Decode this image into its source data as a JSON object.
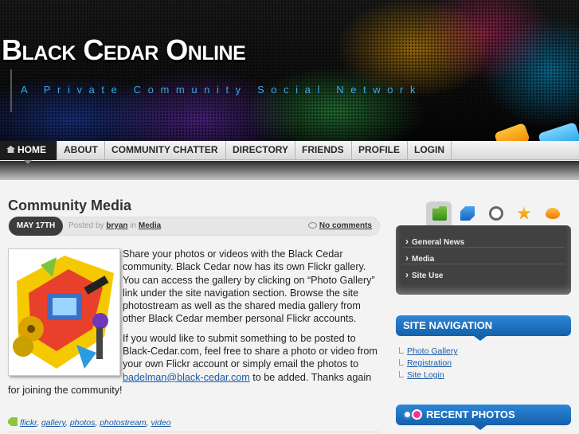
{
  "header": {
    "title": "Black Cedar Online",
    "tagline": "A Private Community Social Network"
  },
  "nav": {
    "items": [
      {
        "label": "HOME",
        "active": true
      },
      {
        "label": "ABOUT"
      },
      {
        "label": "COMMUNITY CHATTER"
      },
      {
        "label": "DIRECTORY"
      },
      {
        "label": "FRIENDS"
      },
      {
        "label": "PROFILE"
      },
      {
        "label": "LOGIN"
      }
    ]
  },
  "post": {
    "title": "Community Media",
    "date": "MAY 17TH",
    "posted_by": "Posted by",
    "author": "bryan",
    "in_word": "in",
    "category": "Media",
    "comments": "No comments",
    "p1": "Share your photos or videos with the Black Cedar community. Black Cedar now has its own Flickr gallery. You can access the gallery by clicking on “Photo Gallery” link under the site navigation section. Browse the site photostream as well as the shared media gallery from other Black Cedar member personal Flickr accounts.",
    "p2_before": "If you would like to submit something to be posted to Black-Cedar.com, feel free to share a photo or video from your own Flickr account or simply email the photos to ",
    "p2_email": "badelman@black-cedar.com",
    "p2_after": " to be added. Thanks again for joining the community!",
    "tags": [
      "flickr",
      "gallery",
      "photos",
      "photostream",
      "video"
    ]
  },
  "sidebar": {
    "tab_icons": [
      "folder-icon",
      "tag-icon",
      "clock-icon",
      "star-icon",
      "chat-icon"
    ],
    "categories": [
      "General News",
      "Media",
      "Site Use"
    ],
    "site_nav_title": "SITE NAVIGATION",
    "site_nav_links": [
      "Photo Gallery",
      "Registration",
      "Site Login"
    ],
    "recent_photos_title": "RECENT PHOTOS"
  },
  "colors": {
    "accent_blue": "#1a5aa8",
    "widget_blue": "#2d86d6",
    "tagline": "#39a8e8"
  }
}
